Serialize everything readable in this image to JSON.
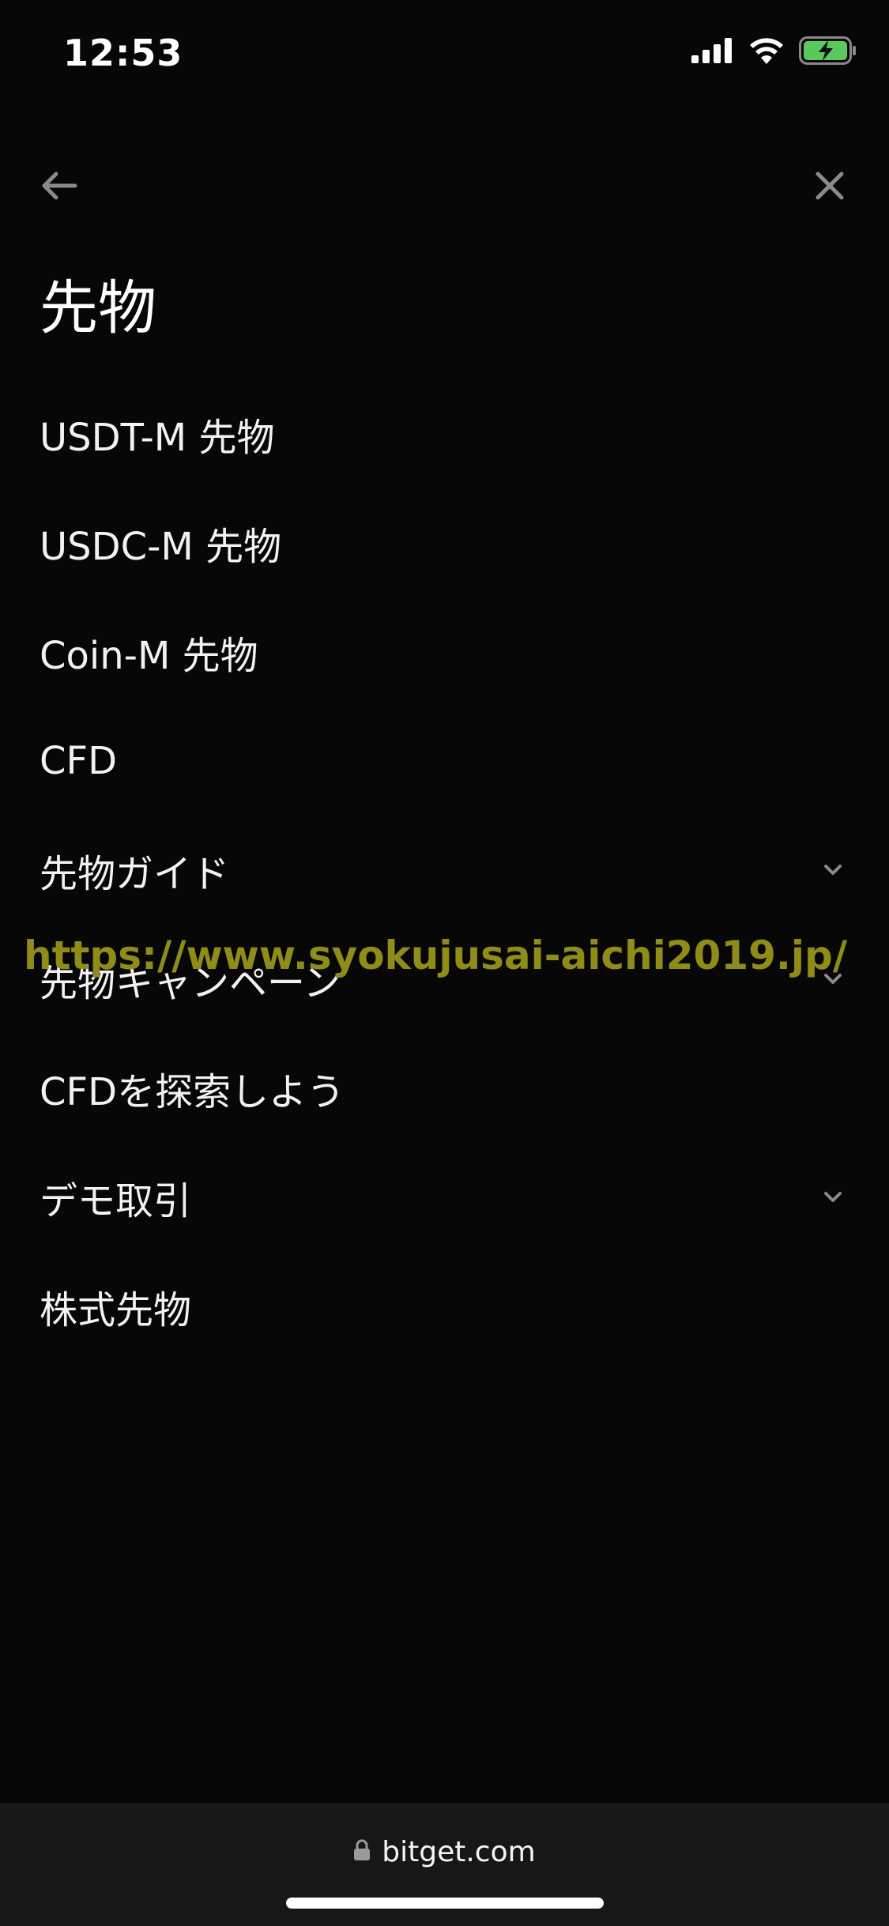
{
  "status_bar": {
    "time": "12:53",
    "signal_icon": "cellular-signal-icon",
    "wifi_icon": "wifi-icon",
    "battery_icon": "battery-charging-icon",
    "battery_color": "#5ac85a"
  },
  "nav": {
    "back_icon": "arrow-left-icon",
    "close_icon": "close-icon"
  },
  "page": {
    "title": "先物"
  },
  "menu": {
    "items": [
      {
        "label": "USDT-M 先物",
        "has_chevron": false
      },
      {
        "label": "USDC-M 先物",
        "has_chevron": false
      },
      {
        "label": "Coin-M 先物",
        "has_chevron": false
      },
      {
        "label": "CFD",
        "has_chevron": false
      },
      {
        "label": "先物ガイド",
        "has_chevron": true
      },
      {
        "label": "先物キャンペーン",
        "has_chevron": true
      },
      {
        "label": "CFDを探索しよう",
        "has_chevron": false
      },
      {
        "label": "デモ取引",
        "has_chevron": true
      },
      {
        "label": "株式先物",
        "has_chevron": false
      }
    ]
  },
  "watermark": {
    "text": "https://www.syokujusai-aichi2019.jp/",
    "color": "#8f8c1a"
  },
  "browser": {
    "lock_icon": "lock-icon",
    "url": "bitget.com"
  },
  "colors": {
    "background": "#070707",
    "text": "#ffffff",
    "bottom_bar": "#171717"
  }
}
